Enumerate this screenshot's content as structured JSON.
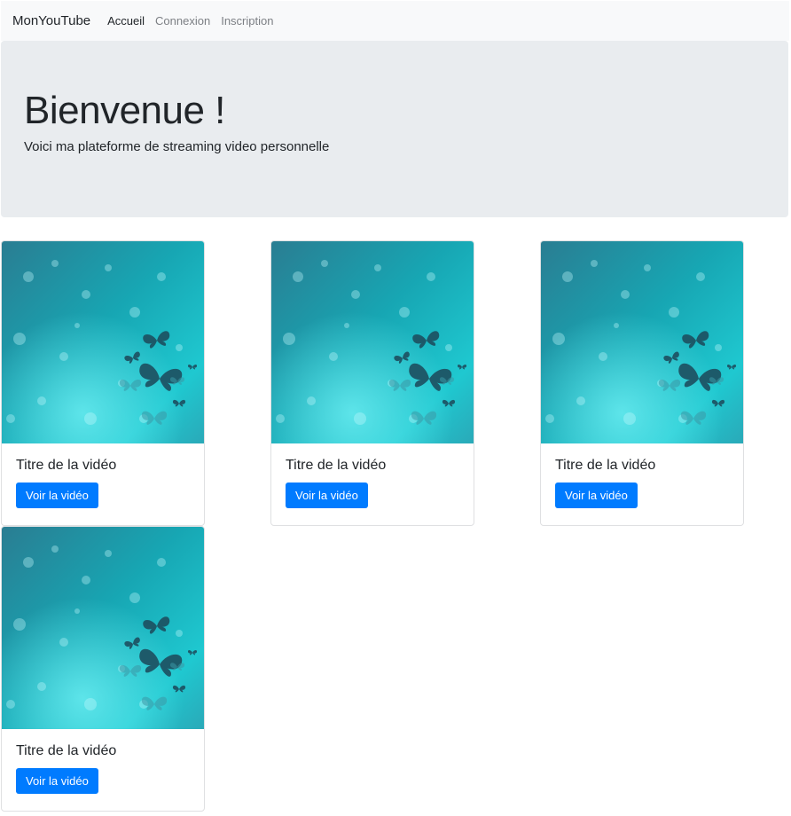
{
  "navbar": {
    "brand": "MonYouTube",
    "links": [
      {
        "label": "Accueil",
        "active": true
      },
      {
        "label": "Connexion",
        "active": false
      },
      {
        "label": "Inscription",
        "active": false
      }
    ]
  },
  "hero": {
    "title": "Bienvenue !",
    "subtitle": "Voici ma plateforme de streaming video personnelle"
  },
  "videos": [
    {
      "title": "Titre de la vidéo",
      "button": "Voir la vidéo",
      "thumbnail": "teal-butterfly-thumbnail"
    },
    {
      "title": "Titre de la vidéo",
      "button": "Voir la vidéo",
      "thumbnail": "teal-butterfly-thumbnail"
    },
    {
      "title": "Titre de la vidéo",
      "button": "Voir la vidéo",
      "thumbnail": "teal-butterfly-thumbnail"
    },
    {
      "title": "Titre de la vidéo",
      "button": "Voir la vidéo",
      "thumbnail": "teal-butterfly-thumbnail"
    }
  ],
  "colors": {
    "primary": "#007bff",
    "navbar_bg": "#f8f9fa",
    "jumbotron_bg": "#e9ecef"
  }
}
